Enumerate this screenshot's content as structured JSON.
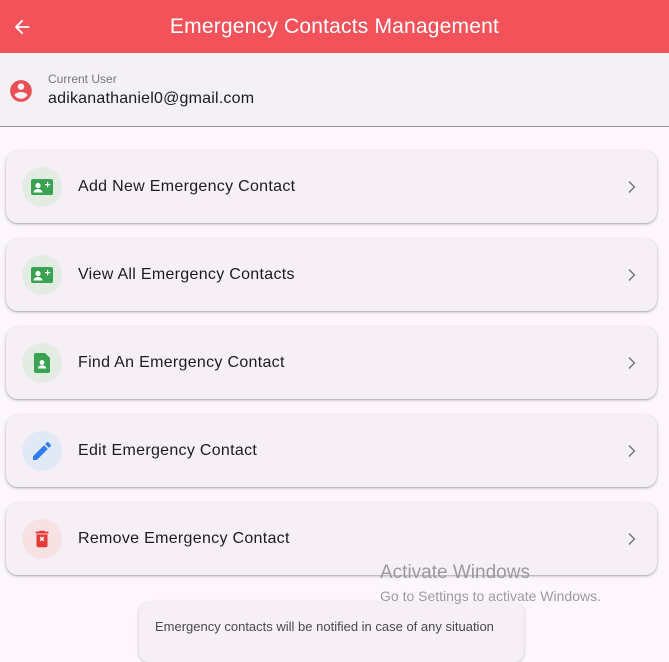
{
  "app": {
    "title": "Emergency Contacts Management",
    "accent_color": "#f3525a",
    "back_icon": "arrow-left-icon"
  },
  "user": {
    "caption": "Current User",
    "email": "adikanathaniel0@gmail.com",
    "avatar_icon": "account-circle-icon"
  },
  "menu": [
    {
      "label": "Add New Emergency Contact",
      "icon": "contact-card-add-icon",
      "icon_color": "#3aa351"
    },
    {
      "label": "View All Emergency Contacts",
      "icon": "contact-card-icon",
      "icon_color": "#3aa351"
    },
    {
      "label": "Find An Emergency Contact",
      "icon": "contact-page-icon",
      "icon_color": "#3aa351"
    },
    {
      "label": "Edit Emergency Contact",
      "icon": "pencil-icon",
      "icon_color": "#2f7ef0"
    },
    {
      "label": "Remove Emergency Contact",
      "icon": "delete-icon",
      "icon_color": "#e53935"
    }
  ],
  "watermark": {
    "title": "Activate Windows",
    "subtitle": "Go to Settings to activate Windows."
  },
  "info": {
    "text": "Emergency contacts will be notified in case of any situation"
  }
}
